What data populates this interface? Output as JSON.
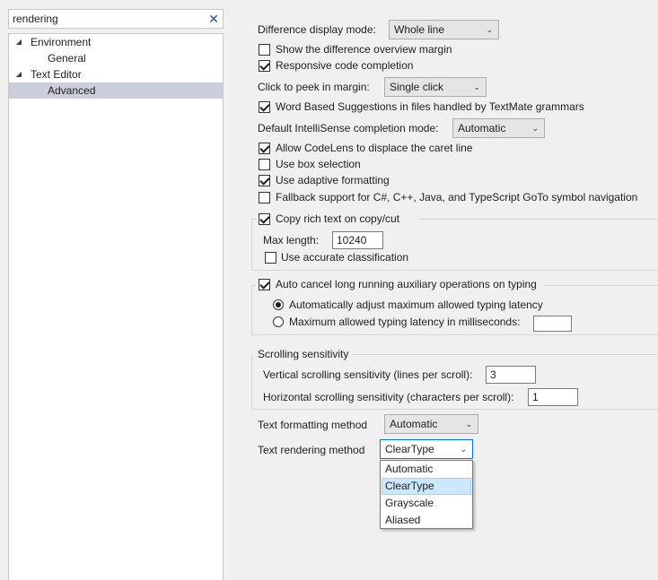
{
  "search": {
    "value": "rendering"
  },
  "tree": {
    "items": [
      {
        "label": "Environment",
        "expanded": true
      },
      {
        "label": "General"
      },
      {
        "label": "Text Editor",
        "expanded": true
      },
      {
        "label": "Advanced",
        "selected": true
      }
    ]
  },
  "settings": {
    "difference_display_mode": {
      "label": "Difference display mode:",
      "value": "Whole line"
    },
    "show_difference_overview_margin": {
      "label": "Show the difference overview margin",
      "checked": false
    },
    "responsive_code_completion": {
      "label": "Responsive code completion",
      "checked": true
    },
    "click_to_peek": {
      "label": "Click to peek in margin:",
      "value": "Single click"
    },
    "word_based_suggestions": {
      "label": "Word Based Suggestions in files handled by TextMate grammars",
      "checked": true
    },
    "default_intellisense_mode": {
      "label": "Default IntelliSense completion mode:",
      "value": "Automatic"
    },
    "allow_codelens": {
      "label": "Allow CodeLens to displace the caret line",
      "checked": true
    },
    "use_box_selection": {
      "label": "Use box selection",
      "checked": false
    },
    "use_adaptive_formatting": {
      "label": "Use adaptive formatting",
      "checked": true
    },
    "fallback_support": {
      "label": "Fallback support for C#, C++, Java, and TypeScript GoTo symbol navigation",
      "checked": false
    },
    "copy_rich_text": {
      "label": "Copy rich text on copy/cut",
      "checked": true
    },
    "max_length": {
      "label": "Max length:",
      "value": "10240"
    },
    "use_accurate_classification": {
      "label": "Use accurate classification",
      "checked": false
    },
    "auto_cancel": {
      "label": "Auto cancel long running auxiliary operations on typing",
      "checked": true
    },
    "auto_adjust_latency": {
      "label": "Automatically adjust maximum allowed typing latency",
      "selected": true
    },
    "max_latency_ms": {
      "label": "Maximum allowed typing latency in milliseconds:",
      "selected": false,
      "value": ""
    },
    "scrolling_sensitivity": {
      "title": "Scrolling sensitivity",
      "vertical_label": "Vertical scrolling sensitivity (lines per scroll):",
      "vertical_value": "3",
      "horizontal_label": "Horizontal scrolling sensitivity (characters per scroll):",
      "horizontal_value": "1"
    },
    "text_formatting_method": {
      "label": "Text formatting method",
      "value": "Automatic"
    },
    "text_rendering_method": {
      "label": "Text rendering method",
      "value": "ClearType",
      "options": [
        "Automatic",
        "ClearType",
        "Grayscale",
        "Aliased"
      ],
      "highlighted": "ClearType"
    }
  },
  "colors": {
    "background": "#f0f0f0",
    "tree_selection": "#cccedb",
    "list_highlight": "#cce8ff",
    "accent": "#0078d7"
  }
}
